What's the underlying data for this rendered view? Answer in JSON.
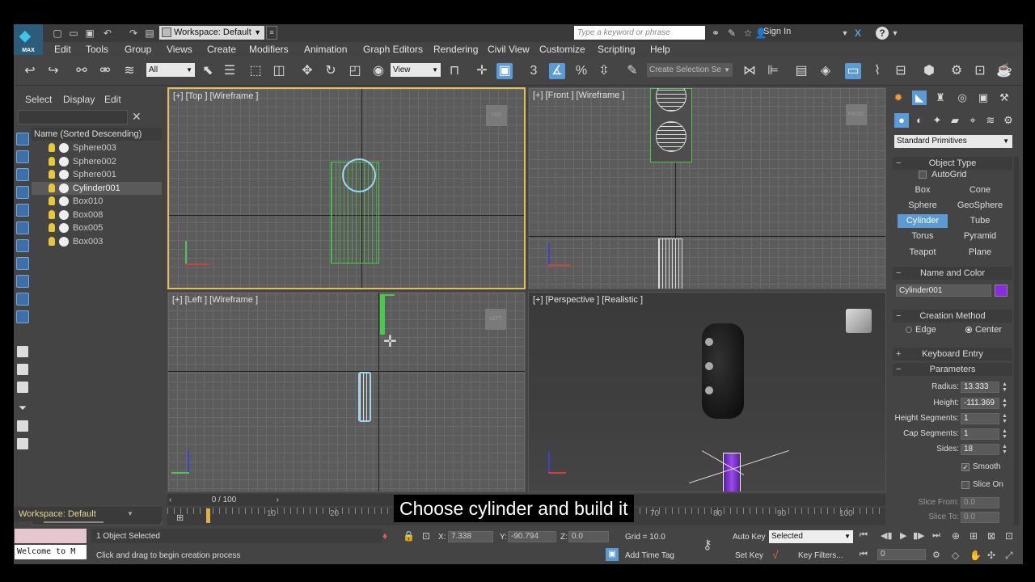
{
  "titlebar": {
    "workspace": "Workspace: Default",
    "search_placeholder": "Type a keyword or phrase",
    "sign_in": "Sign In",
    "logo_text": "MAX"
  },
  "menu": [
    "Edit",
    "Tools",
    "Group",
    "Views",
    "Create",
    "Modifiers",
    "Animation",
    "Graph Editors",
    "Rendering",
    "Civil View",
    "Customize",
    "Scripting",
    "Help"
  ],
  "toolbar": {
    "filter_select": "All",
    "ref_coord_select": "View",
    "selection_set": "Create Selection Se",
    "snap_label": "3"
  },
  "explorer": {
    "tabs": [
      "Select",
      "Display",
      "Edit"
    ],
    "column_header": "Name (Sorted Descending)",
    "items": [
      "Sphere003",
      "Sphere002",
      "Sphere001",
      "Cylinder001",
      "Box010",
      "Box008",
      "Box005",
      "Box003"
    ],
    "selected_index": 3,
    "workspace_footer": "Workspace: Default"
  },
  "viewports": {
    "top": "[+] [Top ] [Wireframe ]",
    "front": "[+] [Front ] [Wireframe ]",
    "left": "[+] [Left ] [Wireframe ]",
    "perspective": "[+] [Perspective ] [Realistic ]",
    "cube_top": "TOP",
    "cube_front": "FRONT",
    "cube_left": "LEFT"
  },
  "command_panel": {
    "primitives_select": "Standard Primitives",
    "object_type": "Object Type",
    "autogrid": "AutoGrid",
    "buttons": [
      "Box",
      "Cone",
      "Sphere",
      "GeoSphere",
      "Cylinder",
      "Tube",
      "Torus",
      "Pyramid",
      "Teapot",
      "Plane"
    ],
    "active_button": "Cylinder",
    "name_and_color": "Name and Color",
    "object_name": "Cylinder001",
    "object_color": "#8a2be2",
    "creation_method": "Creation Method",
    "edge": "Edge",
    "center": "Center",
    "keyboard_entry": "Keyboard Entry",
    "parameters": "Parameters",
    "params": [
      {
        "label": "Radius:",
        "value": "13.333"
      },
      {
        "label": "Height:",
        "value": "-111.369"
      },
      {
        "label": "Height Segments:",
        "value": "1"
      },
      {
        "label": "Cap Segments:",
        "value": "1"
      },
      {
        "label": "Sides:",
        "value": "18"
      }
    ],
    "smooth": "Smooth",
    "slice_on": "Slice On",
    "slice_from_label": "Slice From:",
    "slice_from": "0.0",
    "slice_to_label": "Slice To:",
    "slice_to": "0.0"
  },
  "timeline": {
    "frame": "0 / 100",
    "ticks": [
      "10",
      "20",
      "70",
      "80",
      "90",
      "100"
    ]
  },
  "status": {
    "selected": "1 Object Selected",
    "prompt": "Click and drag to begin creation process",
    "x_label": "X:",
    "x": "7.338",
    "y_label": "Y:",
    "y": "-90.794",
    "z_label": "Z:",
    "z": "0.0",
    "grid": "Grid = 10.0",
    "add_time_tag": "Add Time Tag",
    "auto_key": "Auto Key",
    "auto_key_select": "Selected",
    "set_key": "Set Key",
    "key_filters": "Key Filters...",
    "frame_field": "0",
    "maxscript": "Welcome to M"
  },
  "subtitle": "Choose cylinder and build it"
}
